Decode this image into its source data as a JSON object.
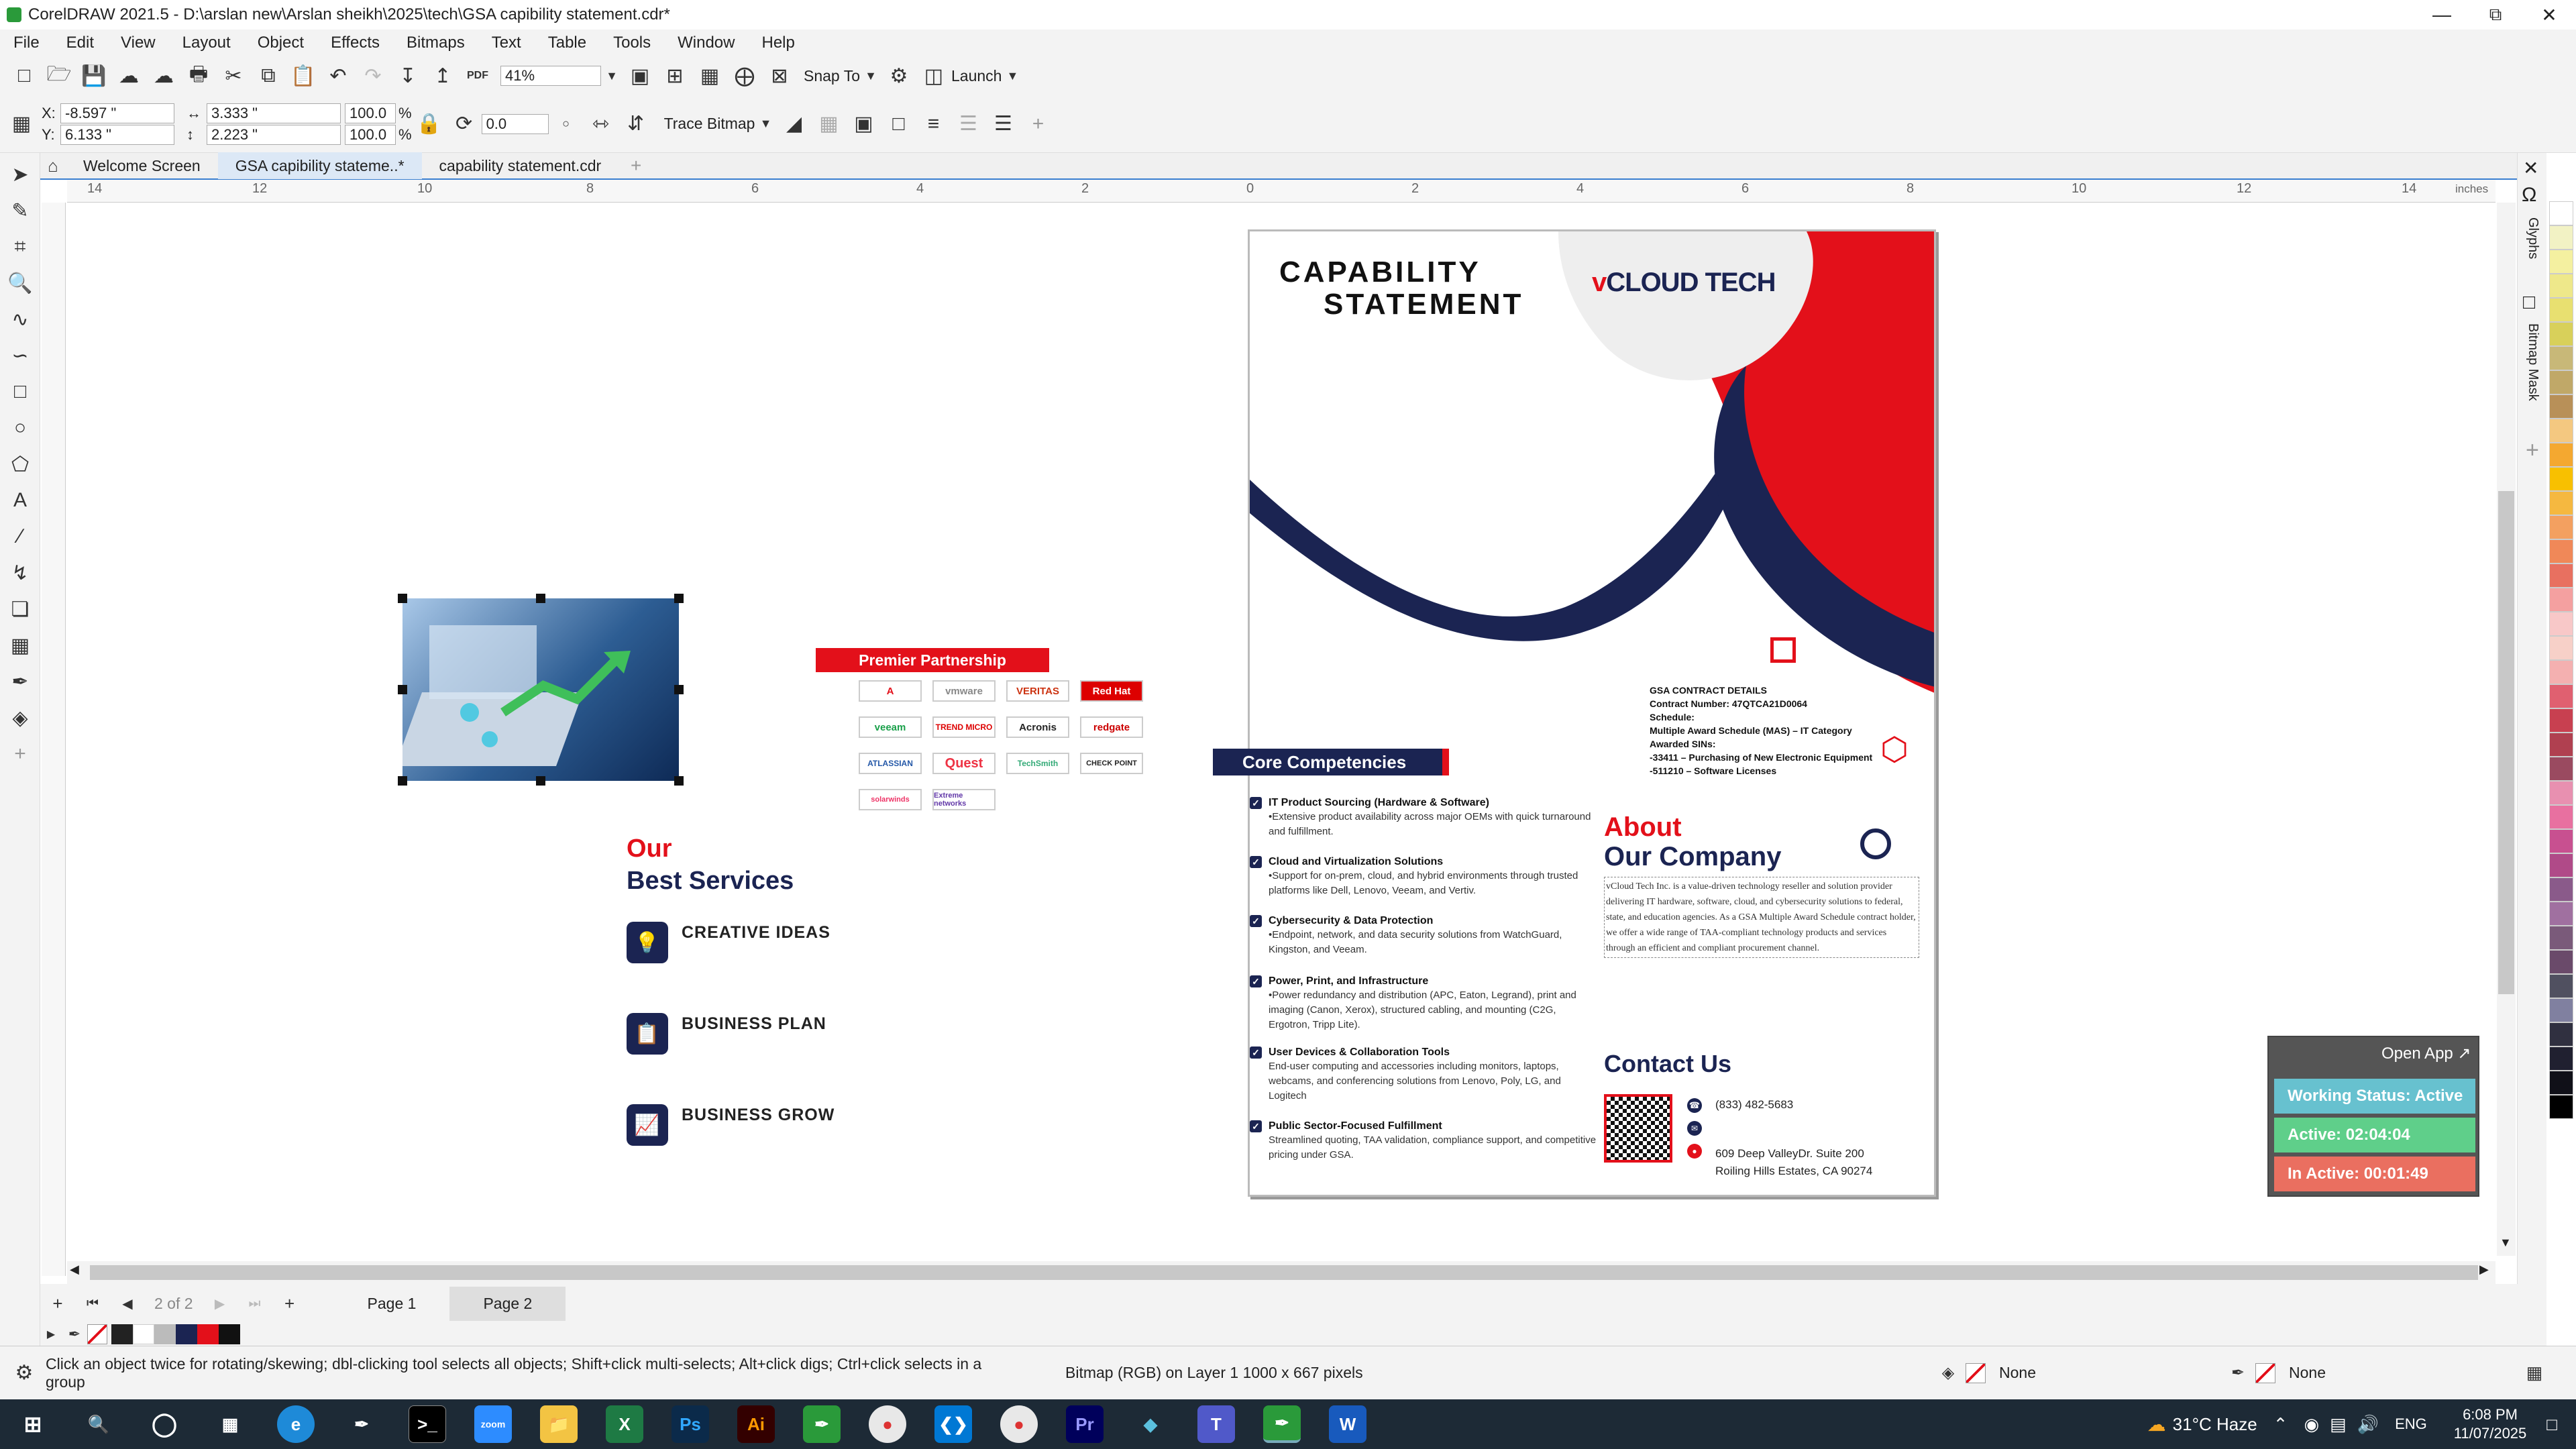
{
  "window": {
    "title": "CorelDRAW 2021.5 - D:\\arslan new\\Arslan sheikh\\2025\\tech\\GSA  capibility statement.cdr*",
    "controls": [
      "minimize",
      "maximize",
      "close"
    ]
  },
  "menu": [
    "File",
    "Edit",
    "View",
    "Layout",
    "Object",
    "Effects",
    "Bitmaps",
    "Text",
    "Table",
    "Tools",
    "Window",
    "Help"
  ],
  "toolbar1": {
    "zoom": "41%",
    "snap_to": "Snap To",
    "launch": "Launch"
  },
  "toolbar2": {
    "x": "-8.597 \"",
    "y": "6.133 \"",
    "w": "3.333 \"",
    "h": "2.223 \"",
    "scale_w": "100.0",
    "scale_h": "100.0",
    "percent": "%",
    "x_label": "X:",
    "y_label": "Y:",
    "angle": "0.0",
    "trace_bitmap": "Trace Bitmap"
  },
  "doc_tabs": [
    {
      "label": "Welcome Screen"
    },
    {
      "label": "GSA  capibility stateme..*"
    },
    {
      "label": "capability statement.cdr"
    }
  ],
  "ruler": {
    "labels": [
      "14",
      "12",
      "10",
      "8",
      "6",
      "4",
      "2",
      "0",
      "2",
      "4",
      "6",
      "8",
      "10",
      "12",
      "14"
    ],
    "unit": "inches"
  },
  "right_dock": {
    "glyphs": "Glyphs",
    "bitmap_mask": "Bitmap Mask"
  },
  "partnership": {
    "title": "Premier Partnership",
    "logos": [
      "A",
      "vmware",
      "VERITAS",
      "Red Hat",
      "veeam",
      "TREND MICRO",
      "Acronis",
      "redgate",
      "ATLASSIAN",
      "Quest",
      "TechSmith",
      "CHECK POINT",
      "solarwinds",
      "Extreme networks"
    ]
  },
  "services": {
    "title_1": "Our",
    "title_2": "Best Services",
    "items": [
      "CREATIVE IDEAS",
      "BUSINESS PLAN",
      "BUSINESS GROW"
    ]
  },
  "page2": {
    "capability_1": "CAPABILITY",
    "capability_2": "STATEMENT",
    "brand_v": "v",
    "brand_rest": "CLOUD TECH",
    "gsa": {
      "title": "GSA CONTRACT DETAILS",
      "contract": "Contract Number: 47QTCA21D0064",
      "schedule_label": "Schedule:",
      "schedule": "Multiple Award Schedule (MAS) – IT Category",
      "sins_label": "Awarded SINs:",
      "sin1": "-33411 – Purchasing of New Electronic Equipment",
      "sin2": "-511210 – Software Licenses"
    },
    "core_title": "Core Competencies",
    "core": [
      {
        "title": "IT Product Sourcing (Hardware & Software)",
        "desc": "•Extensive product availability across major OEMs with quick turnaround and fulfillment."
      },
      {
        "title": "Cloud and Virtualization Solutions",
        "desc": "•Support for on-prem, cloud, and hybrid environments through trusted platforms like Dell, Lenovo, Veeam, and Vertiv."
      },
      {
        "title": "Cybersecurity & Data Protection",
        "desc": "•Endpoint, network, and data security solutions from WatchGuard, Kingston, and Veeam."
      },
      {
        "title": "Power, Print, and Infrastructure",
        "desc": "•Power redundancy and distribution (APC, Eaton, Legrand), print and imaging (Canon, Xerox), structured cabling, and mounting (C2G, Ergotron, Tripp Lite)."
      },
      {
        "title": "User Devices & Collaboration Tools",
        "desc": "End-user computing and accessories including monitors, laptops, webcams, and conferencing solutions from Lenovo, Poly, LG, and Logitech"
      },
      {
        "title": "Public Sector-Focused Fulfillment",
        "desc": "Streamlined quoting, TAA validation, compliance support, and competitive pricing under GSA."
      }
    ],
    "about_1": "About",
    "about_2": "Our Company",
    "about_text": "vCloud Tech Inc. is a value-driven technology reseller and solution provider delivering IT hardware, software, cloud, and cybersecurity solutions to federal, state, and education agencies. As a GSA Multiple Award Schedule contract holder, we offer a wide range of TAA-compliant technology products and services through an efficient and compliant procurement channel.",
    "contact_title": "Contact Us",
    "phone": "(833) 482-5683",
    "address_1": "609 Deep ValleyDr. Suite 200",
    "address_2": "Roiling Hills Estates, CA 90274"
  },
  "tracker": {
    "open_app": "Open App ↗",
    "status": "Working Status: Active",
    "active": "Active: 02:04:04",
    "inactive": "In Active: 00:01:49",
    "colors": {
      "status": "#67c1cf",
      "active": "#5fcf8a",
      "inactive": "#ea6f60"
    }
  },
  "pages": {
    "counter": "2  of  2",
    "page1": "Page 1",
    "page2": "Page 2"
  },
  "status": {
    "hint": "Click an object twice for rotating/skewing; dbl-clicking tool selects all objects; Shift+click multi-selects; Alt+click digs; Ctrl+click selects in a group",
    "object_info": "Bitmap (RGB) on Layer 1 1000 x 667 pixels",
    "fill": "None",
    "outline": "None"
  },
  "taskbar": {
    "weather": "31°C  Haze",
    "lang": "ENG",
    "time": "6:08 PM",
    "date": "11/07/2025"
  },
  "palette_colors": [
    "#ffffff",
    "#f2f2c4",
    "#f4f0a0",
    "#eee88a",
    "#e8e070",
    "#d8d05a",
    "#c8b878",
    "#c0a868",
    "#b89058",
    "#f4c880",
    "#f4a830",
    "#f8c000",
    "#f5b840",
    "#f3a060",
    "#f08858",
    "#e87060",
    "#f4a0a0",
    "#f8c8c8",
    "#f7d0c8",
    "#f4b0b0",
    "#e06070",
    "#c84050",
    "#b04050",
    "#9a4a60",
    "#e890b0",
    "#e870a0",
    "#c85090",
    "#b04a88",
    "#8a5a8a",
    "#a070a0",
    "#7a5a7a",
    "#6a4a6a",
    "#505060",
    "#8080a0",
    "#303040",
    "#202030",
    "#101018",
    "#000000"
  ],
  "colors": {
    "navy": "#1b2452",
    "red": "#e3101a",
    "selection": "#3a7fd0"
  }
}
